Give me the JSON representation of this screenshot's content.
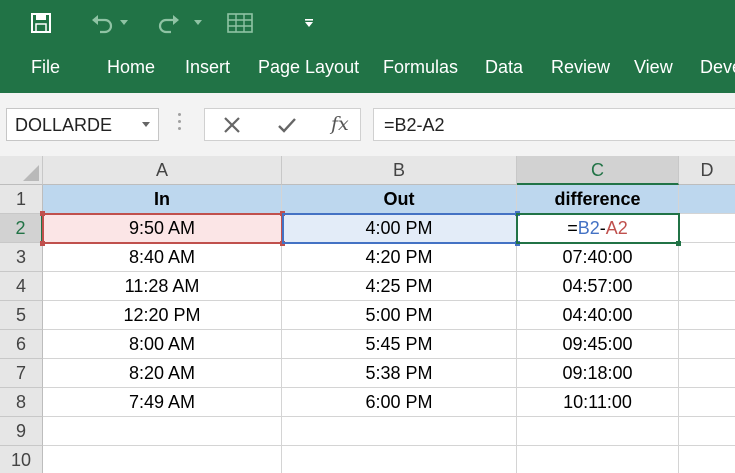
{
  "ribbon": {
    "bg_color": "#217346",
    "quick_access": [
      {
        "name": "save",
        "icon": "save-icon"
      },
      {
        "name": "undo",
        "icon": "undo-icon"
      },
      {
        "name": "redo",
        "icon": "redo-icon"
      },
      {
        "name": "form",
        "icon": "form-icon"
      },
      {
        "name": "customize",
        "icon": "customize-icon"
      }
    ],
    "tabs": [
      "File",
      "Home",
      "Insert",
      "Page Layout",
      "Formulas",
      "Data",
      "Review",
      "View",
      "Deve"
    ]
  },
  "formula_bar": {
    "name_box": "DOLLARDE",
    "cancel_icon": "cancel-icon",
    "enter_icon": "enter-icon",
    "fx_label": "fx",
    "formula": "=B2-A2"
  },
  "sheet": {
    "columns": [
      "A",
      "B",
      "C",
      "D"
    ],
    "rows": [
      "1",
      "2",
      "3",
      "4",
      "5",
      "6",
      "7",
      "8",
      "9",
      "10"
    ],
    "header": [
      "In",
      "Out",
      "difference"
    ],
    "header_fill": "#bdd7ee",
    "data": [
      [
        "9:50 AM",
        "4:00 PM",
        ""
      ],
      [
        "8:40 AM",
        "4:20 PM",
        "07:40:00"
      ],
      [
        "11:28 AM",
        "4:25 PM",
        "04:57:00"
      ],
      [
        "12:20 PM",
        "5:00 PM",
        "04:40:00"
      ],
      [
        "8:00 AM",
        "5:45 PM",
        "09:45:00"
      ],
      [
        "8:20 AM",
        "5:38 PM",
        "09:18:00"
      ],
      [
        "7:49 AM",
        "6:00 PM",
        "10:11:00"
      ]
    ],
    "edit_cell": {
      "prefix": "=",
      "ref1": "B2",
      "op": "-",
      "ref2": "A2",
      "ref1_color": "#4472c4",
      "ref2_color": "#c0504d"
    }
  }
}
